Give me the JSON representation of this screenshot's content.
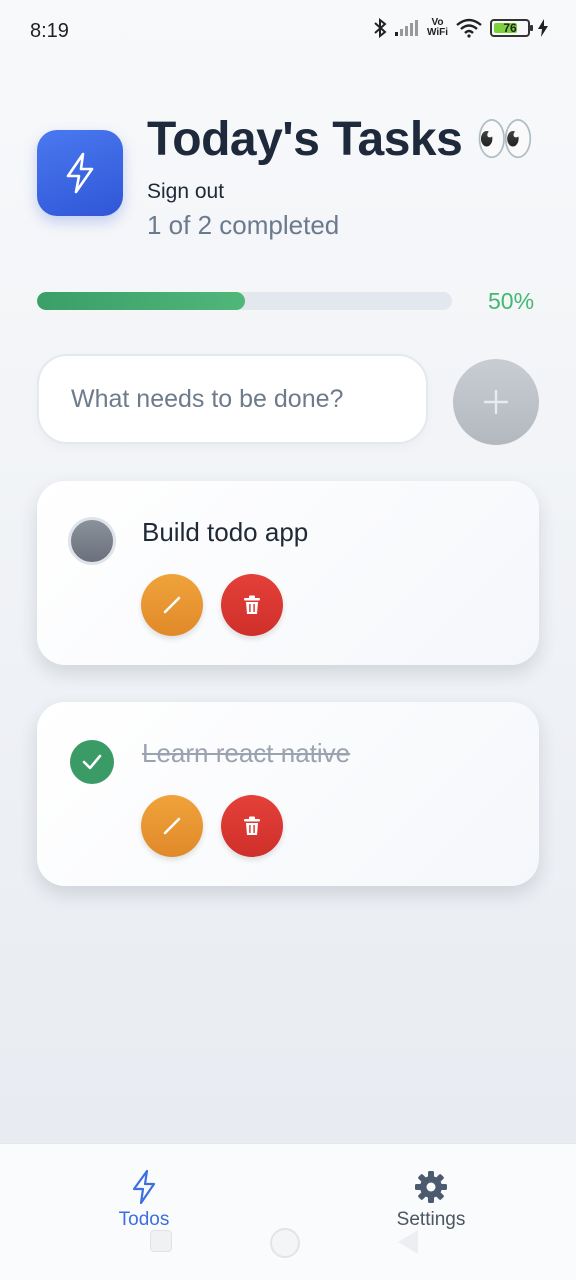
{
  "status_bar": {
    "time": "8:19",
    "vowifi_top": "Vo",
    "vowifi_bottom": "WiFi",
    "battery": "76",
    "battery_level": 0.76
  },
  "header": {
    "title": "Today's Tasks 👀",
    "sign_out": "Sign out",
    "completed_text": "1 of 2 completed"
  },
  "progress": {
    "label": "50%",
    "value": 0.5
  },
  "new_todo": {
    "placeholder": "What needs to be done?",
    "value": ""
  },
  "todos": [
    {
      "text": "Build todo app",
      "completed": false
    },
    {
      "text": "Learn react native",
      "completed": true
    }
  ],
  "bottom_nav": {
    "todos_label": "Todos",
    "settings_label": "Settings"
  },
  "colors": {
    "accent": "#3d6fe0",
    "success": "#43b873",
    "edit": "#e8952f",
    "delete": "#d9352f"
  }
}
